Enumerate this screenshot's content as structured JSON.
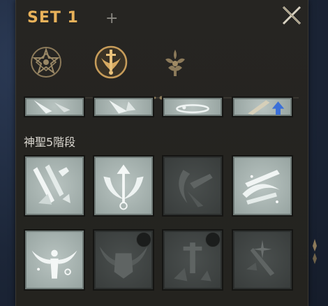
{
  "header": {
    "set_title": "SET 1",
    "add_set_symbol": "+",
    "close_icon": "close-x-icon"
  },
  "tabs": [
    {
      "icon": "star-emblem-icon",
      "active": false
    },
    {
      "icon": "winged-sword-emblem-icon",
      "active": true
    },
    {
      "icon": "fleur-emblem-icon",
      "active": false
    }
  ],
  "section": {
    "label": "神聖5階段"
  },
  "colors": {
    "title_gold": "#e9b25a",
    "panel_bg": "#262522",
    "skill_active": "#a8b3b0",
    "skill_locked": "#404544",
    "highlight_blue": "#3a6fd8"
  },
  "skills_top_row": [
    {
      "icon": "shattered-spear-icon",
      "state": "active"
    },
    {
      "icon": "crystal-shard-icon",
      "state": "active"
    },
    {
      "icon": "ring-burst-icon",
      "state": "active"
    },
    {
      "icon": "blade-upgrade-icon",
      "state": "active"
    }
  ],
  "skills": [
    {
      "icon": "falling-swords-icon",
      "state": "active"
    },
    {
      "icon": "winged-arrow-crest-icon",
      "state": "active"
    },
    {
      "icon": "crescent-slash-icon",
      "state": "locked"
    },
    {
      "icon": "crossed-blades-icon",
      "state": "active"
    },
    {
      "icon": "winged-angel-icon",
      "state": "active"
    },
    {
      "icon": "winged-helm-icon",
      "state": "locked"
    },
    {
      "icon": "impaled-sword-icon",
      "state": "locked"
    },
    {
      "icon": "starburst-slash-icon",
      "state": "locked"
    }
  ]
}
